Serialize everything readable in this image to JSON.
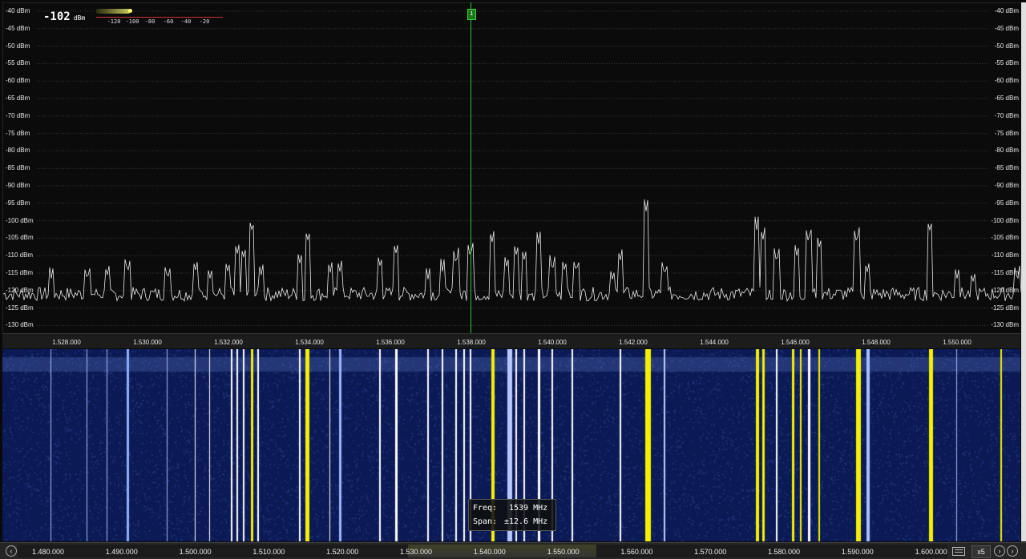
{
  "spectrum": {
    "level_value": "-102",
    "level_unit": "dBm",
    "level_scale_ticks": [
      "-120",
      "-100",
      "-80",
      "-60",
      "-40",
      "-20"
    ],
    "y_axis_labels": [
      "-40 dBm",
      "-45 dBm",
      "-50 dBm",
      "-55 dBm",
      "-60 dBm",
      "-65 dBm",
      "-70 dBm",
      "-75 dBm",
      "-80 dBm",
      "-85 dBm",
      "-90 dBm",
      "-95 dBm",
      "-100 dBm",
      "-105 dBm",
      "-110 dBm",
      "-115 dBm",
      "-120 dBm",
      "-125 dBm",
      "-130 dBm"
    ],
    "x_axis_labels": [
      "1.528.000",
      "1.530.000",
      "1.532.000",
      "1.534.000",
      "1.536.000",
      "1.538.000",
      "1.540.000",
      "1.542.000",
      "1.544.000",
      "1.546.000",
      "1.548.000",
      "1.550.000"
    ],
    "marker_label": "1",
    "trace_color": "#e8e8e8",
    "grid_color": "#3a3a3a",
    "marker_color": "#2ec42e"
  },
  "waterfall": {
    "background_color": "#0b1a55",
    "signal_color": "#f5f000"
  },
  "tooltip": {
    "freq_label": "Freq:",
    "freq_value": "1539 MHz",
    "span_label": "Span:",
    "span_value": "±12.6 MHz"
  },
  "bottom_bar": {
    "overview_labels": [
      "1.480.000",
      "1.490.000",
      "1.500.000",
      "1.510.000",
      "1.520.000",
      "1.530.000",
      "1.540.000",
      "1.550.000",
      "1.560.000",
      "1.570.000",
      "1.580.000",
      "1.590.000",
      "1.600.000"
    ],
    "zoom_label": "x5",
    "left_icon": "chevron-left-icon",
    "right_icon": "chevron-right-icon",
    "keyboard_icon": "keyboard-icon"
  }
}
